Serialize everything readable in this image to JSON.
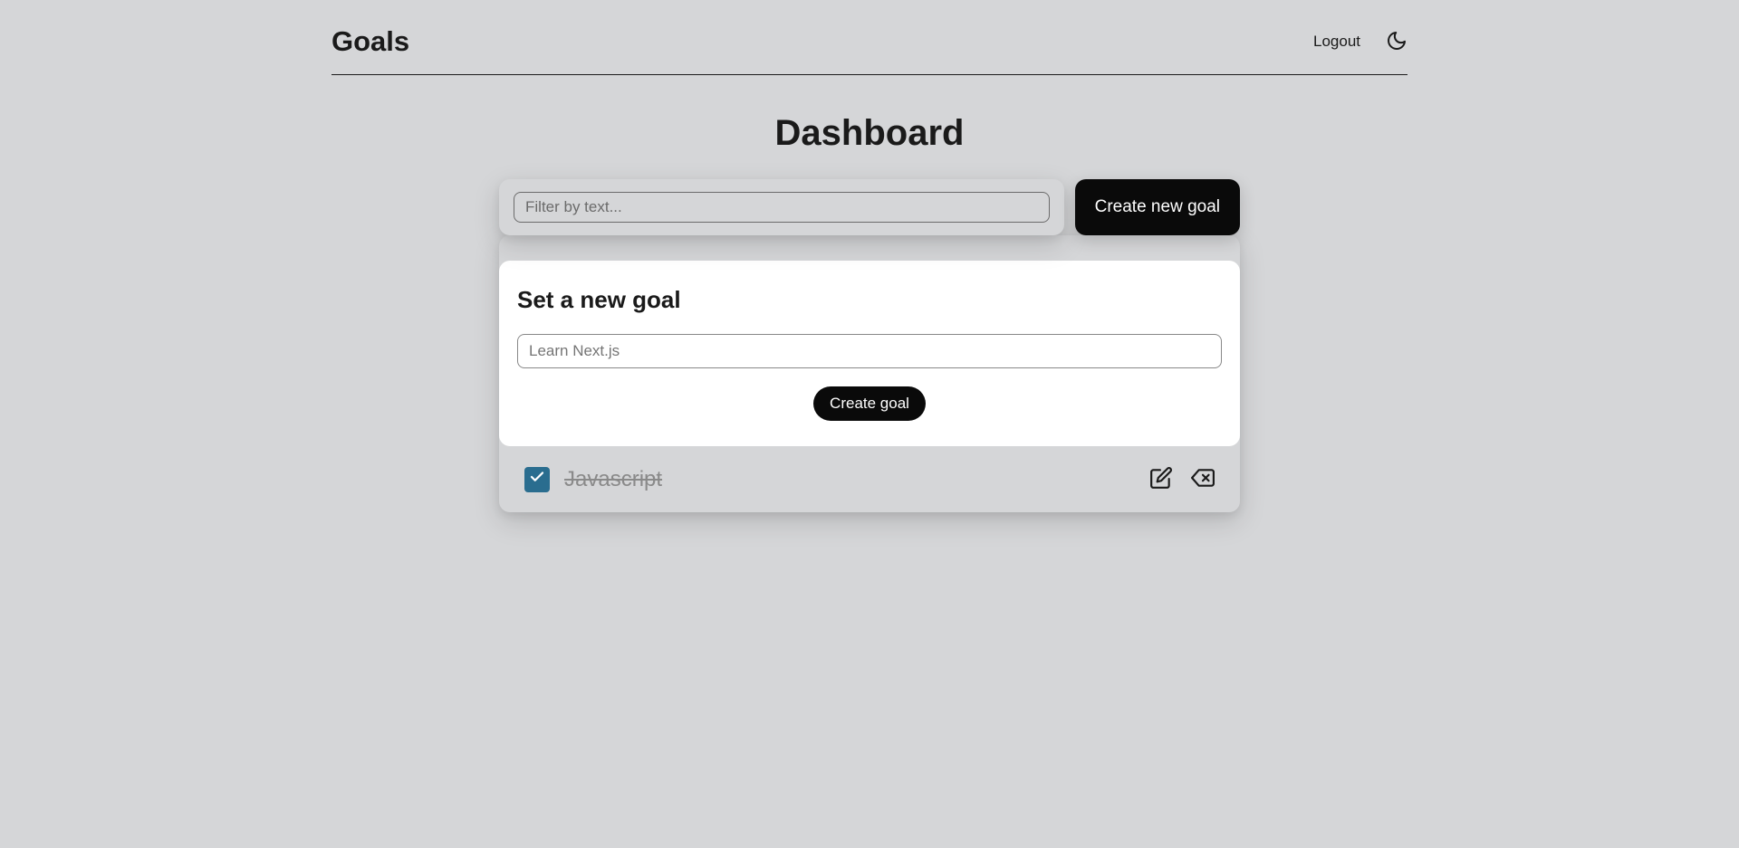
{
  "header": {
    "logo": "Goals",
    "logout": "Logout"
  },
  "dashboard": {
    "title": "Dashboard",
    "filter_placeholder": "Filter by text...",
    "create_button": "Create new goal"
  },
  "form": {
    "title": "Set a new goal",
    "input_placeholder": "Learn Next.js",
    "submit": "Create goal"
  },
  "goals": [
    {
      "text": "Javascript",
      "completed": true
    }
  ]
}
